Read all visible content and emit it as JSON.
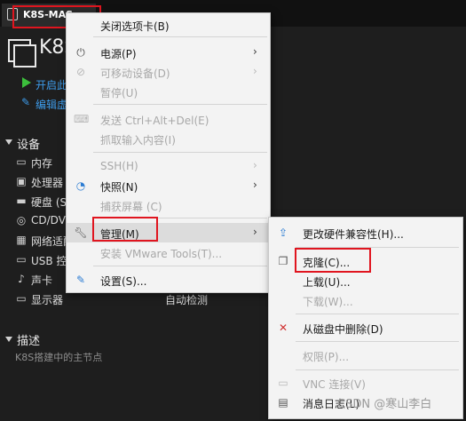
{
  "tab": {
    "label": "K8S-MAS"
  },
  "vm": {
    "title": "K8S"
  },
  "actions": {
    "start": "开启此",
    "edit": "编辑虚"
  },
  "sections": {
    "devices": "设备",
    "description": "描述"
  },
  "devices": [
    {
      "icon": "memory-icon",
      "label": "内存"
    },
    {
      "icon": "cpu-icon",
      "label": "处理器"
    },
    {
      "icon": "disk-icon",
      "label": "硬盘 (S"
    },
    {
      "icon": "cd-icon",
      "label": "CD/DV"
    },
    {
      "icon": "network-icon",
      "label": "网络适配"
    },
    {
      "icon": "usb-icon",
      "label": "USB 控"
    },
    {
      "icon": "sound-icon",
      "label": "声卡"
    },
    {
      "icon": "display-icon",
      "label": "显示器"
    }
  ],
  "display_value": "自动检测",
  "description_text": "K8S搭建中的主节点",
  "main_menu": {
    "close_tab": "关闭选项卡(B)",
    "power": "电源(P)",
    "removable": "可移动设备(D)",
    "pause": "暂停(U)",
    "send_cad": "发送 Ctrl+Alt+Del(E)",
    "grab_input": "抓取输入内容(I)",
    "ssh": "SSH(H)",
    "snapshot": "快照(N)",
    "capture_screen": "捕获屏幕 (C)",
    "manage": "管理(M)",
    "install_tools": "安装 VMware Tools(T)...",
    "settings": "设置(S)..."
  },
  "sub_menu": {
    "change_hw": "更改硬件兼容性(H)...",
    "clone": "克隆(C)...",
    "upload": "上载(U)...",
    "download": "下载(W)...",
    "delete_disk": "从磁盘中删除(D)",
    "permissions": "权限(P)...",
    "vnc": "VNC 连接(V)",
    "message_log": "消息日志(L)"
  },
  "watermark": "CSDN @寒山李白",
  "colors": {
    "highlight_box": "#e0151f",
    "accent": "#3d9be9",
    "play": "#3cbf3c"
  }
}
